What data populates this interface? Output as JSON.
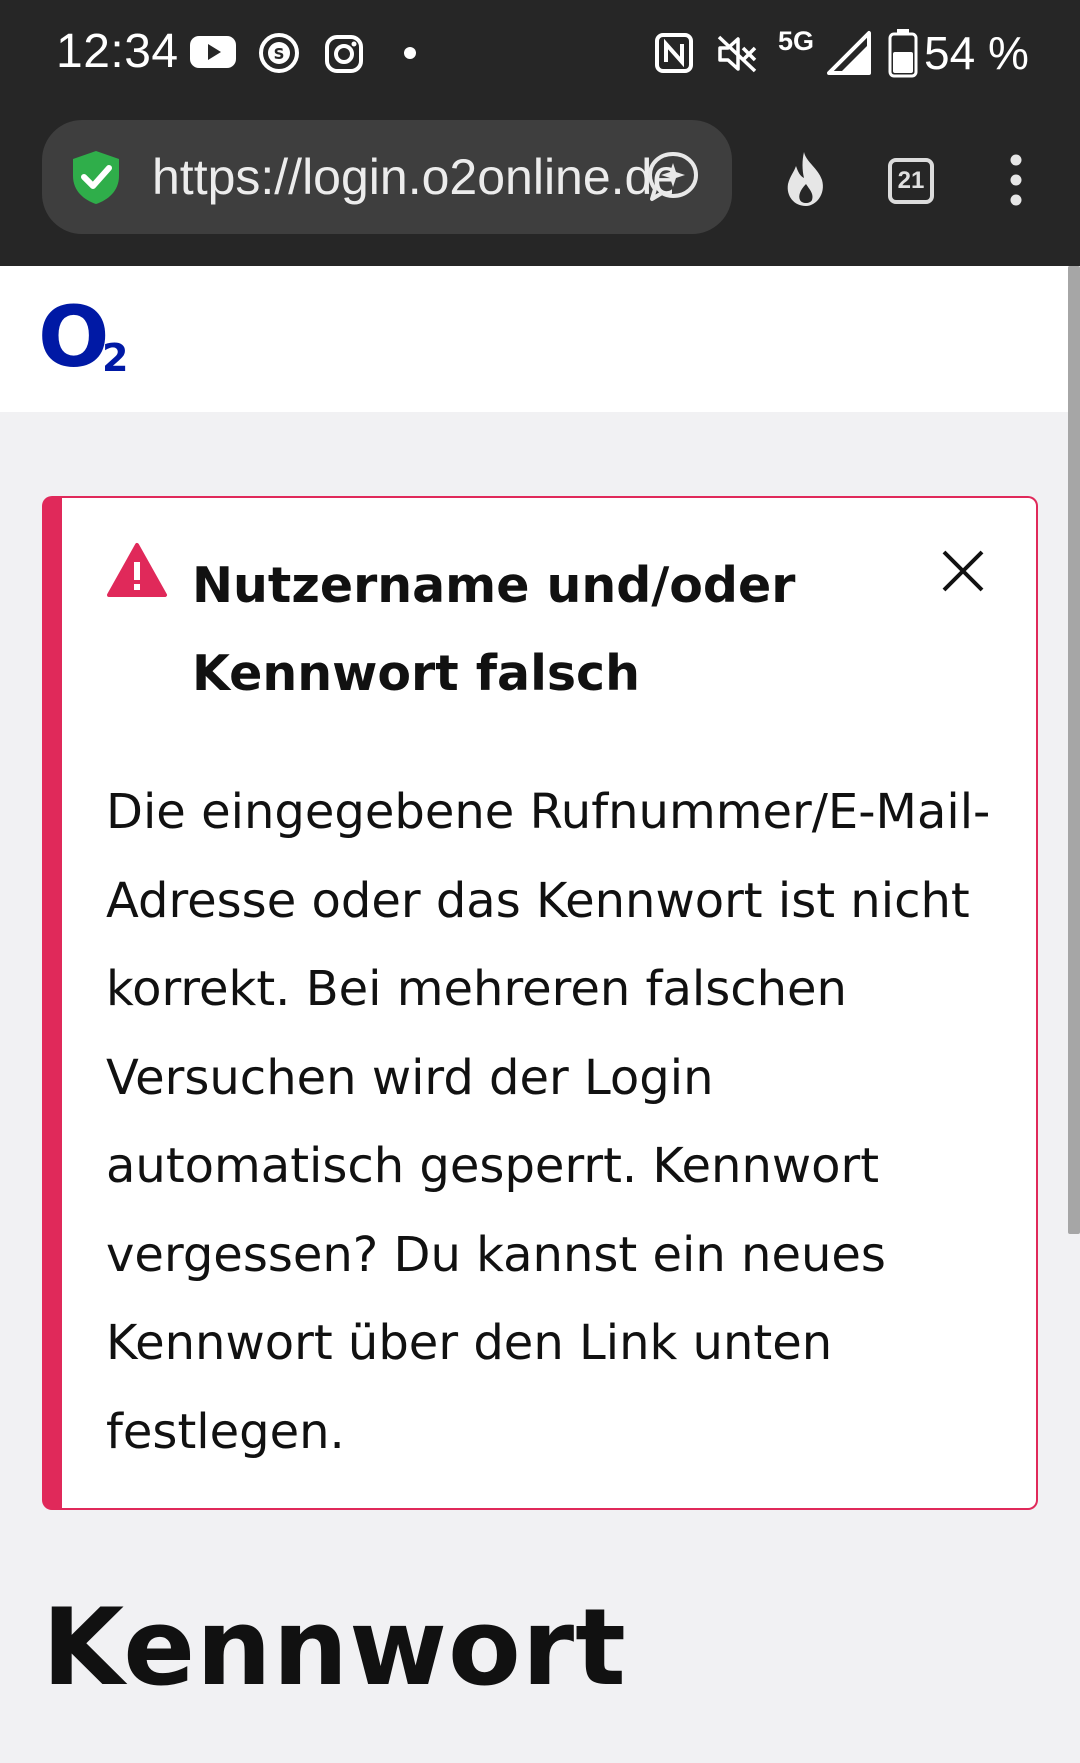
{
  "status_bar": {
    "time": "12:34",
    "network": "5G",
    "battery": "54 %",
    "icons": [
      "youtube-icon",
      "schalke-icon",
      "instagram-icon",
      "dot-icon",
      "nfc-icon",
      "mute-icon",
      "signal-icon",
      "battery-icon"
    ]
  },
  "browser": {
    "url": "https://login.o2online.de",
    "tabs_count": "21",
    "icons": [
      "shield-check-icon",
      "assistant-icon",
      "fire-icon",
      "tabs-icon",
      "more-icon"
    ]
  },
  "site": {
    "logo_text": "O",
    "logo_sub": "2",
    "brand_color": "#0019a5"
  },
  "alert": {
    "title": "Nutzername und/oder Kennwort falsch",
    "body": "Die eingegebene Rufnummer/E-Mail-Adresse oder das Kennwort ist nicht korrekt. Bei mehreren falschen Versuchen wird der Login automatisch gesperrt. Kennwort vergessen? Du kannst ein neues Kennwort über den Link unten festlegen.",
    "accent_color": "#e0295a"
  },
  "page": {
    "heading": "Kennwort"
  }
}
